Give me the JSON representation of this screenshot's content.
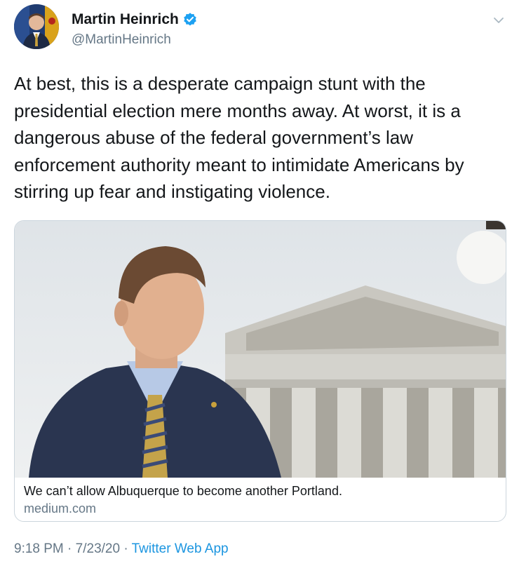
{
  "author": {
    "display_name": "Martin Heinrich",
    "handle": "@MartinHeinrich",
    "verified": true,
    "verified_color": "#1da1f2"
  },
  "tweet": {
    "text": "At best, this is a desperate campaign stunt with the presidential election mere months away. At worst, it is a dangerous abuse of the federal government’s law enforcement authority meant to intimidate Americans by stirring up fear and instigating violence."
  },
  "card": {
    "title": "We can’t allow Albuquerque to become another Portland.",
    "domain": "medium.com",
    "image_description_icon": "photo-of-man-in-front-of-capitol"
  },
  "meta": {
    "time": "9:18 PM",
    "separator": " · ",
    "date": "7/23/20",
    "source": "Twitter Web App"
  },
  "colors": {
    "text": "#14171a",
    "secondary": "#657786",
    "link": "#1b95e0",
    "border": "#ccd6dd"
  }
}
